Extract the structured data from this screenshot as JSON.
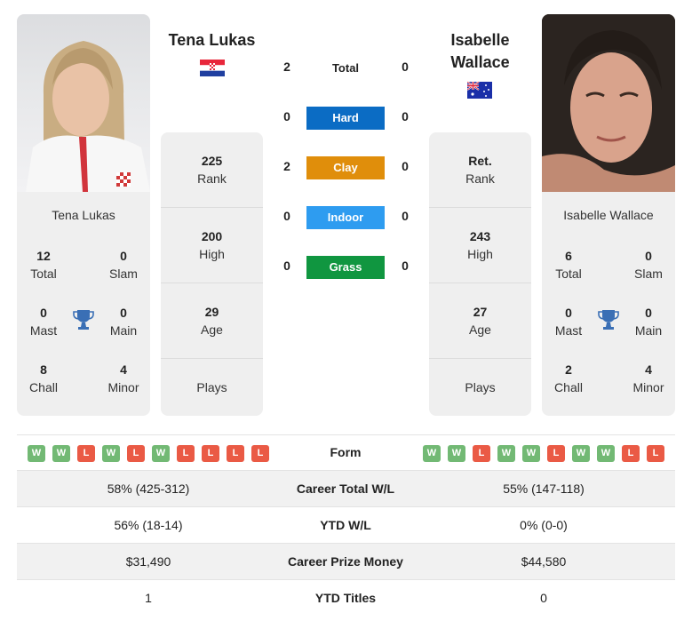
{
  "player1": {
    "name": "Tena Lukas",
    "country_flag": "croatia-flag",
    "titles": {
      "total": {
        "value": "12",
        "label": "Total"
      },
      "slam": {
        "value": "0",
        "label": "Slam"
      },
      "mast": {
        "value": "0",
        "label": "Mast"
      },
      "main": {
        "value": "0",
        "label": "Main"
      },
      "chall": {
        "value": "8",
        "label": "Chall"
      },
      "minor": {
        "value": "4",
        "label": "Minor"
      }
    },
    "stats": {
      "rank": {
        "value": "225",
        "label": "Rank"
      },
      "high": {
        "value": "200",
        "label": "High"
      },
      "age": {
        "value": "29",
        "label": "Age"
      },
      "plays": {
        "value": "",
        "label": "Plays"
      }
    },
    "form": [
      "W",
      "W",
      "L",
      "W",
      "L",
      "W",
      "L",
      "L",
      "L",
      "L"
    ]
  },
  "player2": {
    "name_line1": "Isabelle",
    "name_line2": "Wallace",
    "name": "Isabelle Wallace",
    "country_flag": "australia-flag",
    "titles": {
      "total": {
        "value": "6",
        "label": "Total"
      },
      "slam": {
        "value": "0",
        "label": "Slam"
      },
      "mast": {
        "value": "0",
        "label": "Mast"
      },
      "main": {
        "value": "0",
        "label": "Main"
      },
      "chall": {
        "value": "2",
        "label": "Chall"
      },
      "minor": {
        "value": "4",
        "label": "Minor"
      }
    },
    "stats": {
      "rank": {
        "value": "Ret.",
        "label": "Rank"
      },
      "high": {
        "value": "243",
        "label": "High"
      },
      "age": {
        "value": "27",
        "label": "Age"
      },
      "plays": {
        "value": "",
        "label": "Plays"
      }
    },
    "form": [
      "W",
      "W",
      "L",
      "W",
      "W",
      "L",
      "W",
      "W",
      "L",
      "L"
    ]
  },
  "h2h": {
    "total": {
      "label": "Total",
      "p1": "2",
      "p2": "0"
    },
    "surfaces": [
      {
        "label": "Hard",
        "p1": "0",
        "p2": "0",
        "color": "#0b6cc4"
      },
      {
        "label": "Clay",
        "p1": "2",
        "p2": "0",
        "color": "#e08e0b"
      },
      {
        "label": "Indoor",
        "p1": "0",
        "p2": "0",
        "color": "#2e9cf0"
      },
      {
        "label": "Grass",
        "p1": "0",
        "p2": "0",
        "color": "#109640"
      }
    ]
  },
  "comparison": {
    "form_label": "Form",
    "rows": [
      {
        "label": "Career Total W/L",
        "p1": "58% (425-312)",
        "p2": "55% (147-118)"
      },
      {
        "label": "YTD W/L",
        "p1": "56% (18-14)",
        "p2": "0% (0-0)"
      },
      {
        "label": "Career Prize Money",
        "p1": "$31,490",
        "p2": "$44,580"
      },
      {
        "label": "YTD Titles",
        "p1": "1",
        "p2": "0"
      }
    ]
  },
  "colors": {
    "win": "#72b974",
    "loss": "#ea5a45",
    "trophy": "#3a6fb5",
    "panel": "#efefef"
  }
}
